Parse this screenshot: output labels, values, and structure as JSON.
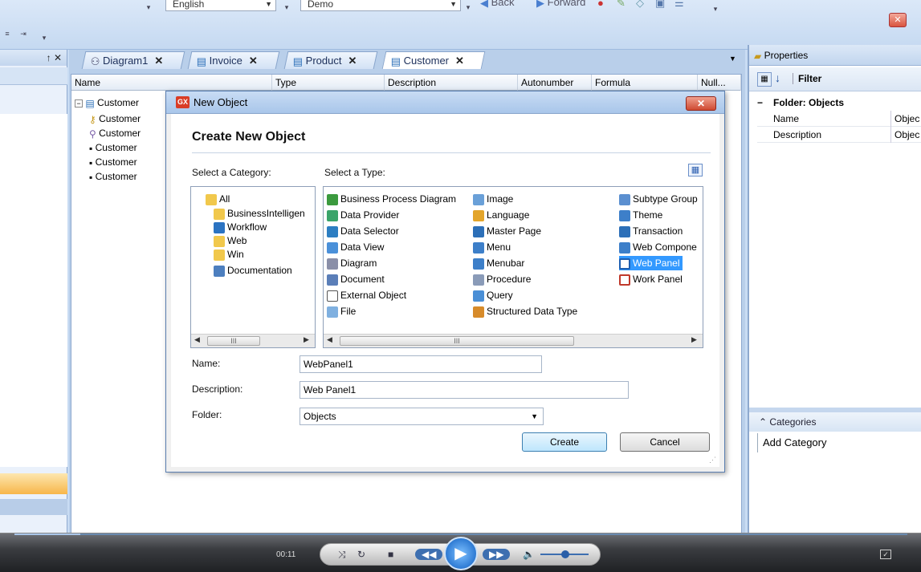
{
  "toolbar": {
    "language_value": "English",
    "env_value": "Demo",
    "back_label": "Back",
    "forward_label": "Forward"
  },
  "left_panel": {
    "pin_label": "↑ ✕"
  },
  "tabs": [
    {
      "label": "Diagram1",
      "icon": "diagram-icon"
    },
    {
      "label": "Invoice",
      "icon": "transaction-icon"
    },
    {
      "label": "Product",
      "icon": "transaction-icon"
    },
    {
      "label": "Customer",
      "icon": "transaction-icon"
    }
  ],
  "grid": {
    "columns": [
      "Name",
      "Type",
      "Description",
      "Autonumber",
      "Formula",
      "Null..."
    ],
    "rows": [
      {
        "label": "Customer",
        "icon": "transaction-icon"
      },
      {
        "label": "Customer",
        "icon": "key-icon"
      },
      {
        "label": "Customer",
        "icon": "search-icon"
      },
      {
        "label": "Customer",
        "icon": "bullet-icon"
      },
      {
        "label": "Customer",
        "icon": "bullet-icon"
      },
      {
        "label": "Customer",
        "icon": "bullet-icon"
      }
    ]
  },
  "dialog": {
    "title": "New Object",
    "app_badge": "GX",
    "heading": "Create New Object",
    "category_label": "Select a Category:",
    "type_label": "Select a Type:",
    "categories": [
      {
        "label": "All",
        "icon": "folder-icon"
      },
      {
        "label": "BusinessIntelligen",
        "icon": "folder-icon"
      },
      {
        "label": "Workflow",
        "icon": "workflow-icon"
      },
      {
        "label": "Web",
        "icon": "folder-icon"
      },
      {
        "label": "Win",
        "icon": "folder-icon"
      },
      {
        "label": "Documentation",
        "icon": "documentation-icon"
      }
    ],
    "types_col1": [
      {
        "label": "Business Process Diagram",
        "icon": "bpd-icon"
      },
      {
        "label": "Data Provider",
        "icon": "data-provider-icon"
      },
      {
        "label": "Data Selector",
        "icon": "data-selector-icon"
      },
      {
        "label": "Data View",
        "icon": "data-view-icon"
      },
      {
        "label": "Diagram",
        "icon": "diagram-icon"
      },
      {
        "label": "Document",
        "icon": "document-icon"
      },
      {
        "label": "External Object",
        "icon": "external-object-icon"
      },
      {
        "label": "File",
        "icon": "file-icon"
      }
    ],
    "types_col2": [
      {
        "label": "Image",
        "icon": "image-icon"
      },
      {
        "label": "Language",
        "icon": "language-icon"
      },
      {
        "label": "Master Page",
        "icon": "master-page-icon"
      },
      {
        "label": "Menu",
        "icon": "menu-icon"
      },
      {
        "label": "Menubar",
        "icon": "menubar-icon"
      },
      {
        "label": "Procedure",
        "icon": "procedure-icon"
      },
      {
        "label": "Query",
        "icon": "query-icon"
      },
      {
        "label": "Structured Data Type",
        "icon": "sdt-icon"
      }
    ],
    "types_col3": [
      {
        "label": "Subtype Group",
        "icon": "subtype-group-icon"
      },
      {
        "label": "Theme",
        "icon": "theme-icon"
      },
      {
        "label": "Transaction",
        "icon": "transaction-icon"
      },
      {
        "label": "Web Compone",
        "icon": "web-component-icon"
      },
      {
        "label": "Web Panel",
        "icon": "web-panel-icon",
        "selected": true
      },
      {
        "label": "Work Panel",
        "icon": "work-panel-icon"
      }
    ],
    "scroll_thumb": "III",
    "name_label": "Name:",
    "name_value": "WebPanel1",
    "description_label": "Description:",
    "description_value": "Web Panel1",
    "folder_label": "Folder:",
    "folder_value": "Objects",
    "create_label": "Create",
    "cancel_label": "Cancel"
  },
  "properties": {
    "title": "Properties",
    "filter_label": "Filter",
    "section": "Folder: Objects",
    "rows": [
      {
        "name": "Name",
        "value": "Objec"
      },
      {
        "name": "Description",
        "value": "Objec"
      }
    ],
    "categories_label": "Categories",
    "add_category_label": "Add Category"
  },
  "player": {
    "time": "00:11"
  },
  "colors": {
    "accent": "#3399ff",
    "selection": "#3399ff",
    "dialog_close": "#cf4a32"
  }
}
